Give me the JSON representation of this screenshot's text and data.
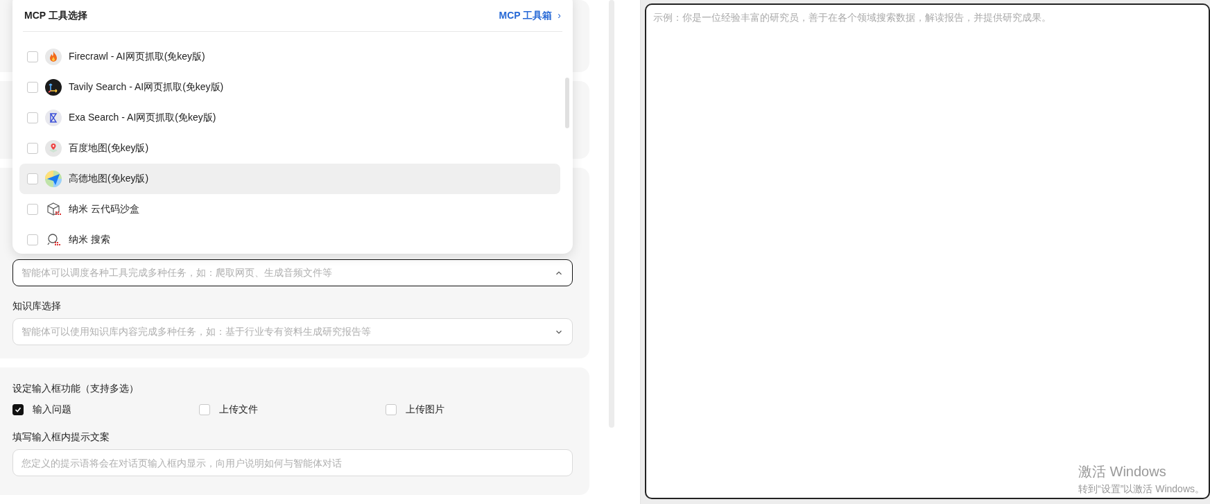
{
  "mcp_popup": {
    "title": "MCP 工具选择",
    "toolbox_link": "MCP 工具箱",
    "link_arrow": "›",
    "tools": [
      {
        "name": "Firecrawl - AI网页抓取(免key版)",
        "kind": "flame",
        "checked": false,
        "highlighted": false
      },
      {
        "name": "Tavily Search - AI网页抓取(免key版)",
        "kind": "axes",
        "checked": false,
        "highlighted": false
      },
      {
        "name": "Exa Search - AI网页抓取(免key版)",
        "kind": "hourglass",
        "checked": false,
        "highlighted": false
      },
      {
        "name": "百度地图(免key版)",
        "kind": "pin",
        "checked": false,
        "highlighted": false
      },
      {
        "name": "高德地图(免key版)",
        "kind": "plane",
        "checked": false,
        "highlighted": true
      },
      {
        "name": "纳米 云代码沙盒",
        "kind": "cube",
        "checked": false,
        "highlighted": false
      },
      {
        "name": "纳米 搜索",
        "kind": "search",
        "checked": false,
        "highlighted": false
      }
    ]
  },
  "mcp_field": {
    "placeholder": "智能体可以调度各种工具完成多种任务，如：爬取网页、生成音频文件等",
    "expanded": true
  },
  "knowledge_base": {
    "label": "知识库选择",
    "placeholder": "智能体可以使用知识库内容完成多种任务，如：基于行业专有资料生成研究报告等",
    "expanded": false
  },
  "input_features": {
    "label": "设定输入框功能（支持多选）",
    "options": [
      {
        "label": "输入问题",
        "checked": true
      },
      {
        "label": "上传文件",
        "checked": false
      },
      {
        "label": "上传图片",
        "checked": false
      }
    ]
  },
  "hint_text": {
    "label": "填写输入框内提示文案",
    "placeholder": "您定义的提示语将会在对话页输入框内显示，向用户说明如何与智能体对话"
  },
  "prompt_editor": {
    "placeholder": "示例：你是一位经验丰富的研究员，善于在各个领域搜索数据，解读报告，并提供研究成果。"
  },
  "os_notice": {
    "title": "激活 Windows",
    "subtitle": "转到“设置”以激活 Windows。"
  }
}
